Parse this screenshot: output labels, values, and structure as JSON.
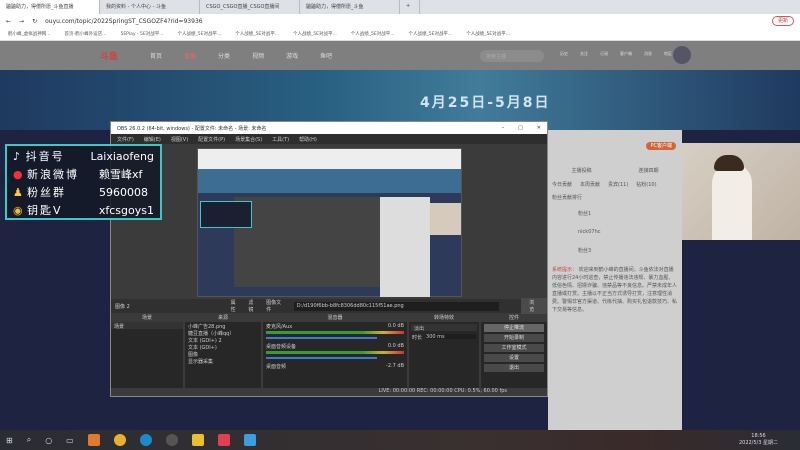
{
  "browser": {
    "tabs": [
      "鼬鼬助力，得偿所愿_斗鱼直播",
      "我的资料 - 个人中心 - 斗鱼",
      "CSGO_CSGO直播_CSGO直播间",
      "鼬鼬助力，得偿所愿_斗鱼"
    ],
    "new_tab": "+",
    "url": "ouyu.com/topic/2022SpringST_CSGOZF4?rid=93936",
    "update_label": "更新",
    "bookmarks": [
      "鹤小峰_虚拟战神网...",
      "首页-鹤小峰外设店...",
      "5EPlay - 5E对战平...",
      "个人战绩_5E对战平...",
      "个人战绩_5E对战平...",
      "个人战绩_5E对战平...",
      "个人战绩_5E对战平...",
      "个人战绩_5E对战平...",
      "个人战绩_5E对战平..."
    ]
  },
  "site": {
    "logo": "斗鱼",
    "nav": [
      "首页",
      "直播",
      "分类",
      "视频",
      "游戏",
      "鱼吧"
    ],
    "search_placeholder": "搜索主播",
    "header_icons": [
      "历史",
      "关注",
      "订阅",
      "客户端",
      "消息",
      "地区"
    ],
    "banner": "4月25日-5月8日"
  },
  "overlay": {
    "rows": [
      {
        "label": "抖音号",
        "value": "Laixiaofeng"
      },
      {
        "label": "新浪微博",
        "value": "赖雪峰xf"
      },
      {
        "label": "粉丝群",
        "value": "5960008"
      },
      {
        "label": "钥匙V",
        "value": "xfcsgoys1"
      }
    ]
  },
  "obs": {
    "title": "OBS 26.0.2 (64-bit, windows) - 配置文件: 未命名 - 场景: 未命名",
    "menu": [
      "文件(F)",
      "编辑(E)",
      "视图(V)",
      "配置文件(P)",
      "场景集合(S)",
      "工具(T)",
      "帮助(H)"
    ],
    "source_name": "图像 2",
    "properties": "属性",
    "filters": "滤镜",
    "image_file_label": "图像文件",
    "image_path": "D:/d190f6bb-b8fc8306dd80c115f51ae.png",
    "browse": "浏览",
    "docks": {
      "scenes": "场景",
      "sources": "来源",
      "mixer": "混音器",
      "transitions": "转场特效",
      "controls": "控件"
    },
    "scenes": [
      "场景"
    ],
    "sources": [
      "小峰广告28.png",
      "糖豆直播（小峰qq）",
      "文本 (GDI+) 2",
      "文本 (GDI+)",
      "图像",
      "显示器采集"
    ],
    "mixer": [
      {
        "name": "麦克风/Aux",
        "db": "0.0 dB"
      },
      {
        "name": "桌面音频设备",
        "db": "0.0 dB"
      },
      {
        "name": "桌面音频",
        "db": "-2.7 dB"
      }
    ],
    "transition": "淡出",
    "duration_label": "时长",
    "duration": "300 ms",
    "controls": [
      "停止推流",
      "开始录制",
      "工作室模式",
      "设置",
      "退出"
    ],
    "status": "LIVE: 00:00:00   REC: 00:00:00   CPU: 0.5%, 60.00 fps"
  },
  "sidepanel": {
    "buttons": [
      "PC客户端"
    ],
    "links": [
      "主播投稿",
      "连接四期"
    ],
    "tabs": [
      "今日贡献",
      "本周贡献",
      "贵宾(11)",
      "钻粉(10)"
    ],
    "rank_title": "粉丝贡献排行",
    "users": [
      "粉丝1",
      "nick07hc",
      "粉丝3"
    ],
    "notice_label": "系统提示：",
    "notice": "欢迎来到鹤小峰的直播间。斗鱼依法对直播内容进行24小时巡查，禁止传播违法违规、暴力血腥、低俗色情、招嫖诈骗、违禁品等不良信息。严禁未成年人直播或打赏。主播以不正当方式诱导打赏，注意理性消费。警惕非官方渠道、代练代抽、购买礼包退款技巧、私下交易等信息。"
  },
  "taskbar": {
    "time": "18:56",
    "date": "2022/5/3 星期二"
  }
}
